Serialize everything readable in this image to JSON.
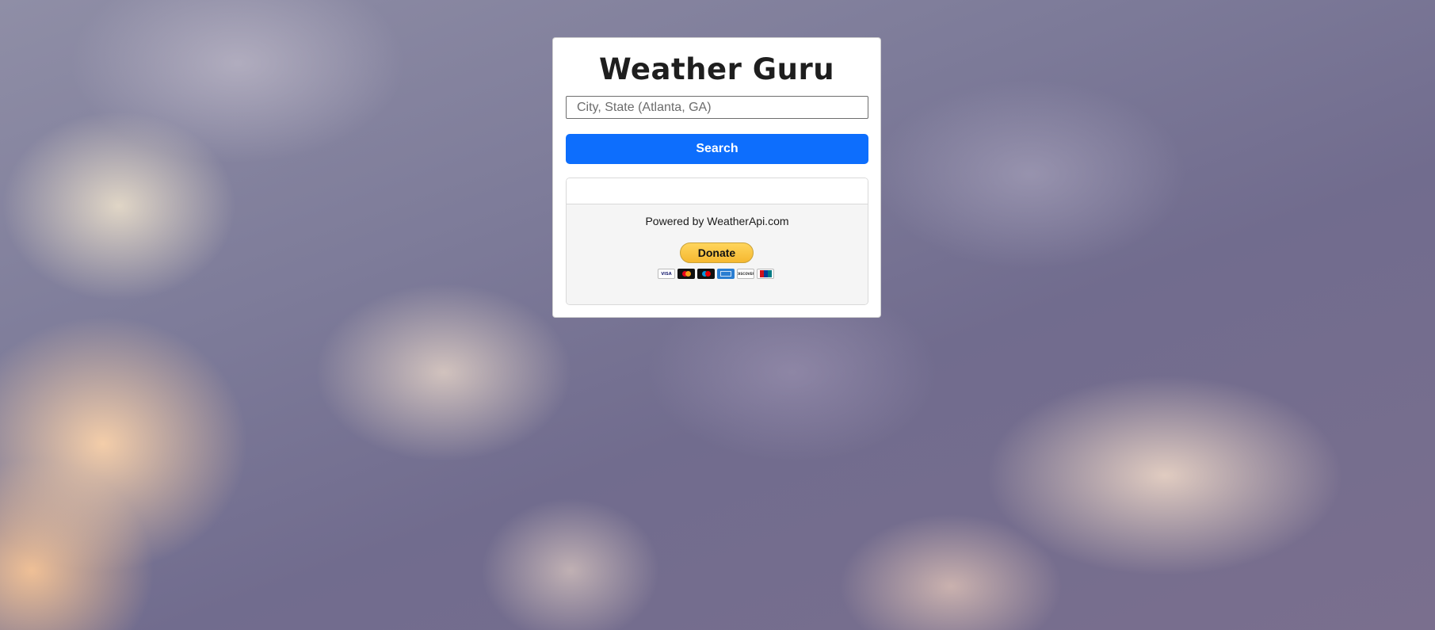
{
  "app": {
    "title": "Weather Guru"
  },
  "search": {
    "placeholder": "City, State (Atlanta, GA)",
    "value": "",
    "button_label": "Search"
  },
  "results": {
    "powered_by": "Powered by WeatherApi.com",
    "donate_label": "Donate",
    "payment_cards": [
      {
        "label": "VISA",
        "icon": "visa-card-icon"
      },
      {
        "label": "",
        "icon": "mastercard-icon"
      },
      {
        "label": "",
        "icon": "maestro-card-icon"
      },
      {
        "label": "",
        "icon": "amex-card-icon"
      },
      {
        "label": "DISCOVER",
        "icon": "discover-card-icon"
      },
      {
        "label": "",
        "icon": "unionpay-card-icon"
      }
    ]
  },
  "colors": {
    "primary_button": "#0d6efd",
    "donate_button": "#f5b830"
  }
}
